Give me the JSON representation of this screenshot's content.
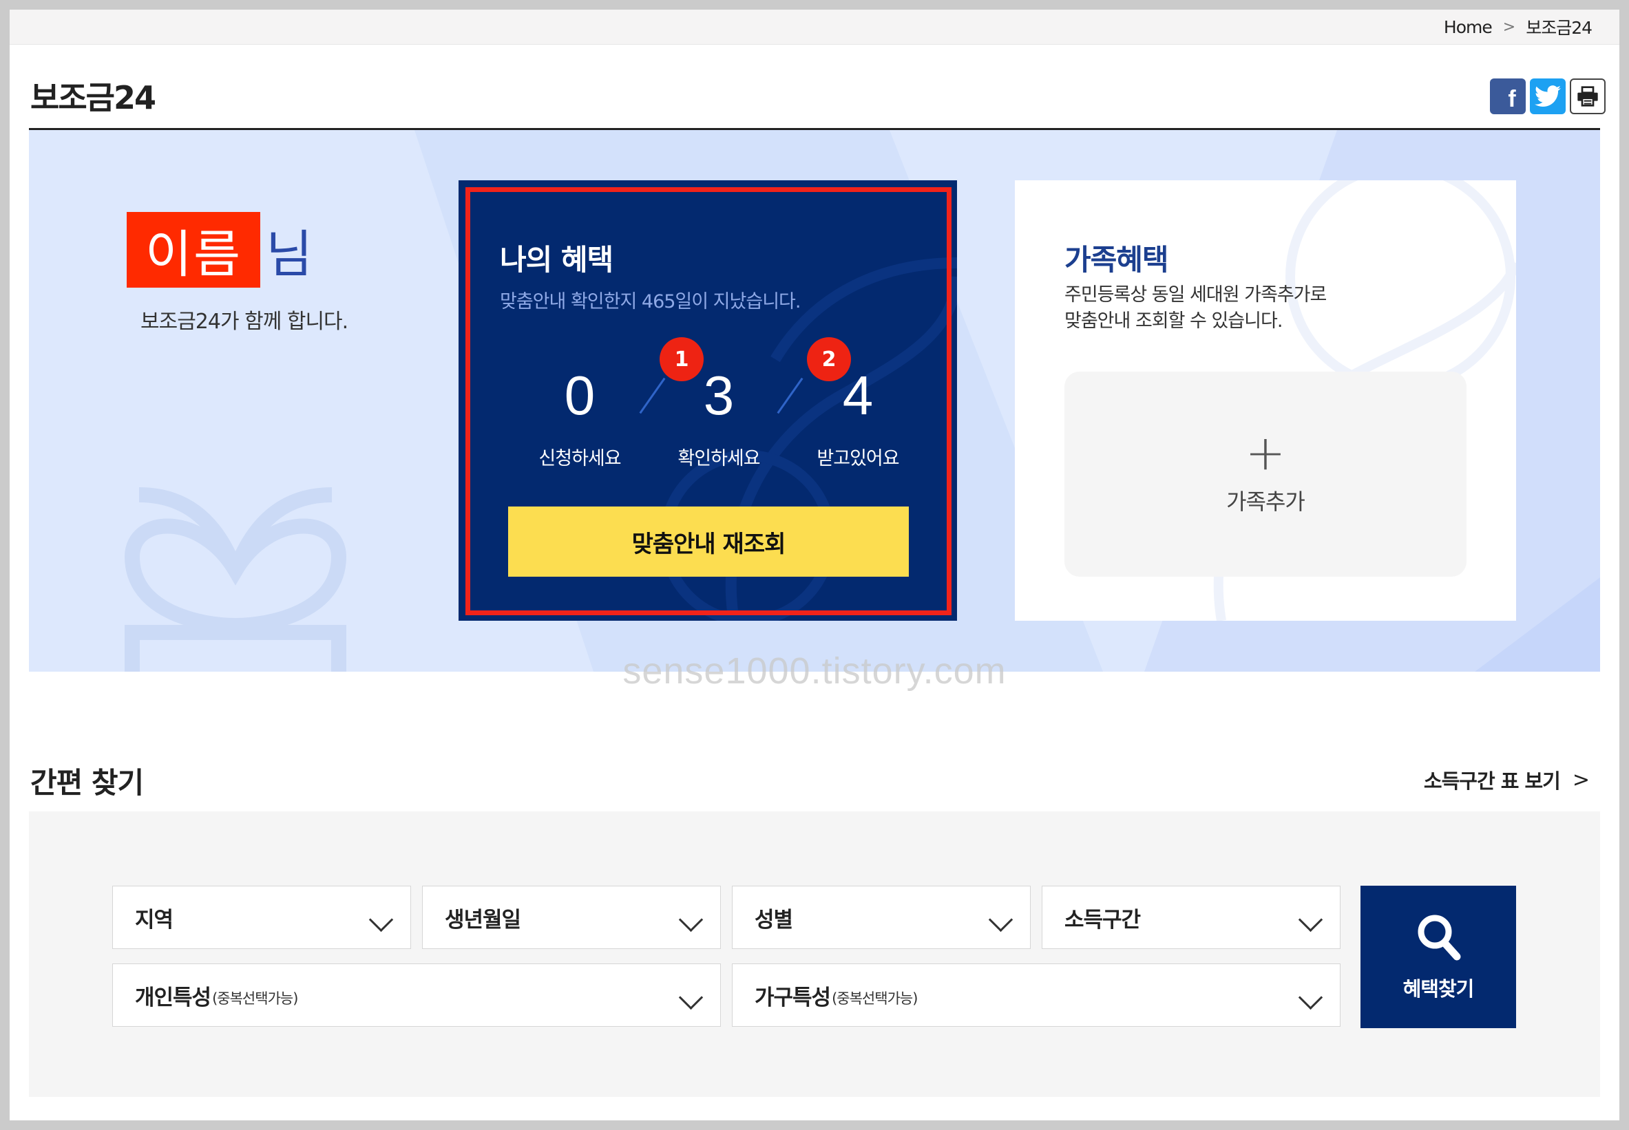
{
  "breadcrumb": {
    "home": "Home",
    "separator": ">",
    "current": "보조금24"
  },
  "page": {
    "title": "보조금24"
  },
  "share": {
    "facebook_glyph": "f",
    "twitter_icon": "twitter-icon",
    "print_icon": "printer-icon"
  },
  "greeting": {
    "name": "이름",
    "suffix": "님",
    "subtitle": "보조금24가 함께 합니다."
  },
  "my_benefits": {
    "title": "나의 혜택",
    "subtitle": "맞춤안내 확인한지 465일이 지났습니다.",
    "stats": [
      {
        "value": "0",
        "label": "신청하세요"
      },
      {
        "value": "3",
        "label": "확인하세요"
      },
      {
        "value": "4",
        "label": "받고있어요"
      }
    ],
    "badges": [
      "1",
      "2"
    ],
    "button_label": "맞춤안내 재조회"
  },
  "family": {
    "title": "가족혜택",
    "desc_line1": "주민등록상 동일 세대원 가족추가로",
    "desc_line2": "맞춤안내 조회할 수 있습니다.",
    "add_symbol": "+",
    "add_label": "가족추가"
  },
  "watermark": "sense1000.tistory.com",
  "quick_search": {
    "title": "간편 찾기",
    "income_link": "소득구간 표 보기",
    "income_chevron": ">",
    "selects": {
      "region": "지역",
      "birth": "생년월일",
      "gender": "성별",
      "income": "소득구간",
      "personal": "개인특성",
      "household": "가구특성"
    },
    "multi_note": "(중복선택가능)",
    "search_button": "혜택찾기"
  },
  "colors": {
    "navy": "#03296f",
    "highlight_red": "#f2231a",
    "badge_red": "#ee2313",
    "button_yellow": "#fcdd50",
    "hero_bg": "#dde8fd",
    "family_title": "#1c3f8f"
  }
}
